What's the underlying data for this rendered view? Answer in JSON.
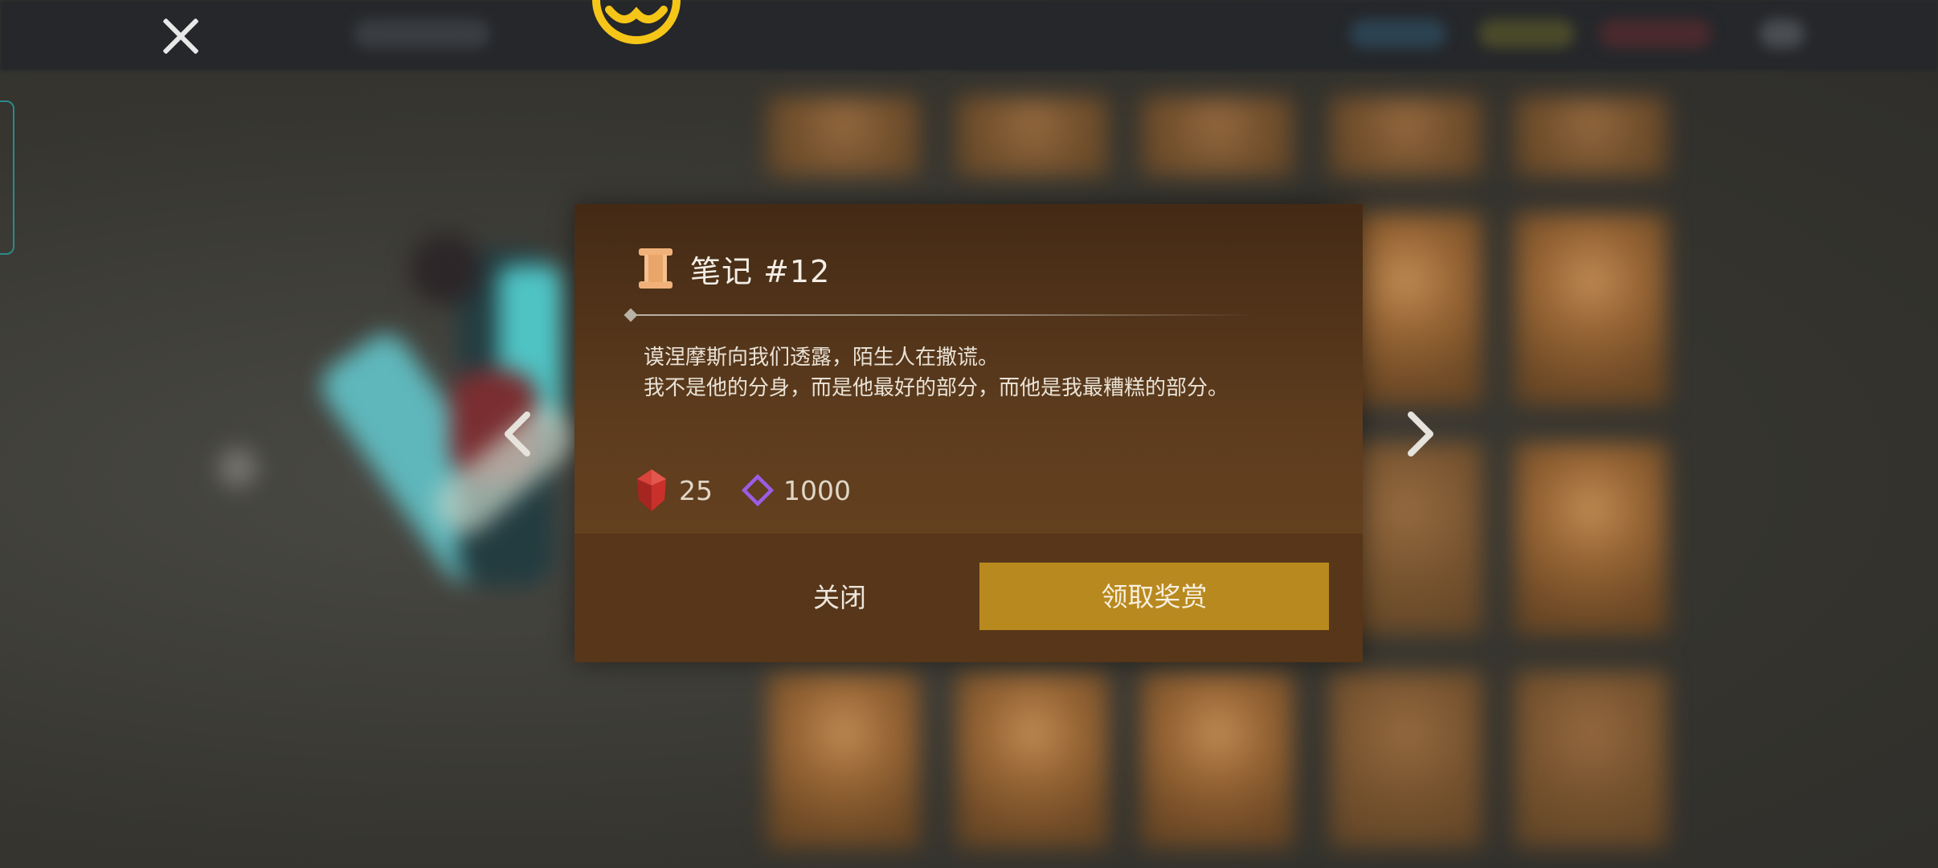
{
  "dialog": {
    "title": "笔记 #12",
    "body_lines": [
      "谟涅摩斯向我们透露，陌生人在撒谎。",
      "我不是他的分身，而是他最好的部分，而他是我最糟糕的部分。"
    ],
    "rewards": [
      {
        "icon": "red-gem-icon",
        "amount": "25",
        "color": "#d0352c"
      },
      {
        "icon": "purple-diamond-icon",
        "amount": "1000",
        "color": "#9b5de5"
      }
    ],
    "close_label": "关闭",
    "claim_label": "领取奖赏"
  },
  "colors": {
    "dialog_bg": "#5c3b1d",
    "footer_bg": "#573619",
    "claim_button": "#b8891f",
    "emblem": "#f5c518"
  },
  "icons": {
    "top_close": "close-icon",
    "header": "scroll-icon",
    "prev": "chevron-left-icon",
    "next": "chevron-right-icon",
    "emblem": "gold-emblem-icon"
  }
}
